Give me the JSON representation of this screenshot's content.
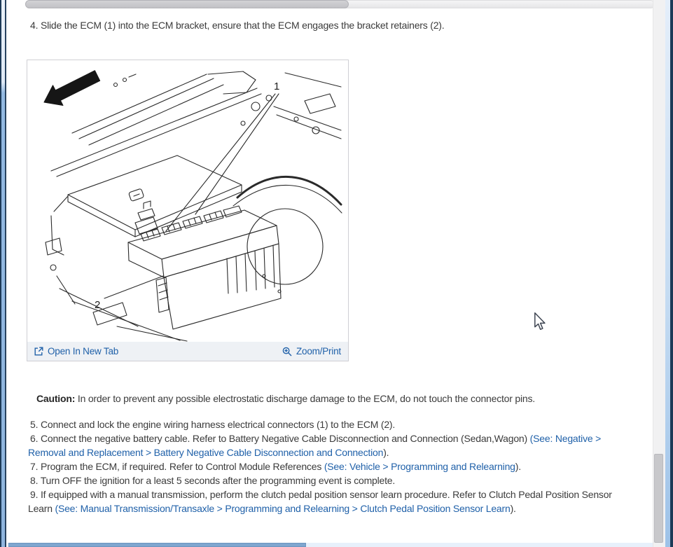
{
  "instructions": {
    "step4": "4. Slide the ECM (1) into the ECM bracket, ensure that the ECM engages the bracket retainers (2)."
  },
  "figure": {
    "callout_1": "1",
    "callout_2": "2",
    "open_in_new_tab_label": "Open In New Tab",
    "zoom_print_label": "Zoom/Print"
  },
  "caution": {
    "label": "Caution:",
    "text": "In order to prevent any possible electrostatic discharge damage to the ECM, do not touch the connector pins."
  },
  "steps": {
    "step5": {
      "text": "5. Connect and lock the engine wiring harness electrical connectors (1) to the ECM (2)."
    },
    "step6": {
      "pre": "6. Connect the negative battery cable. Refer to Battery Negative Cable Disconnection and Connection (Sedan,Wagon) ",
      "link_line1": "(See: Negative >",
      "link_line2": "Removal and Replacement > Battery Negative Cable Disconnection and Connection",
      "post": ")."
    },
    "step7": {
      "pre": "7. Program the ECM, if required. Refer to Control Module References ",
      "link": "(See: Vehicle > Programming and Relearning",
      "post": ")."
    },
    "step8": {
      "text": "8. Turn OFF the ignition for a least 5 seconds after the programming event is complete."
    },
    "step9": {
      "pre_line1": "9. If equipped with a manual transmission, perform the clutch pedal position sensor learn procedure. Refer to Clutch Pedal Position Sensor",
      "pre_line2": "Learn ",
      "link": "(See: Manual Transmission/Transaxle > Programming and Relearning > Clutch Pedal Position Sensor Learn",
      "post": ")."
    }
  },
  "colors": {
    "link_blue": "#2061a9",
    "scroll_thumb_blue": "#7fa6cf",
    "frame_navy": "#1d3a57"
  }
}
